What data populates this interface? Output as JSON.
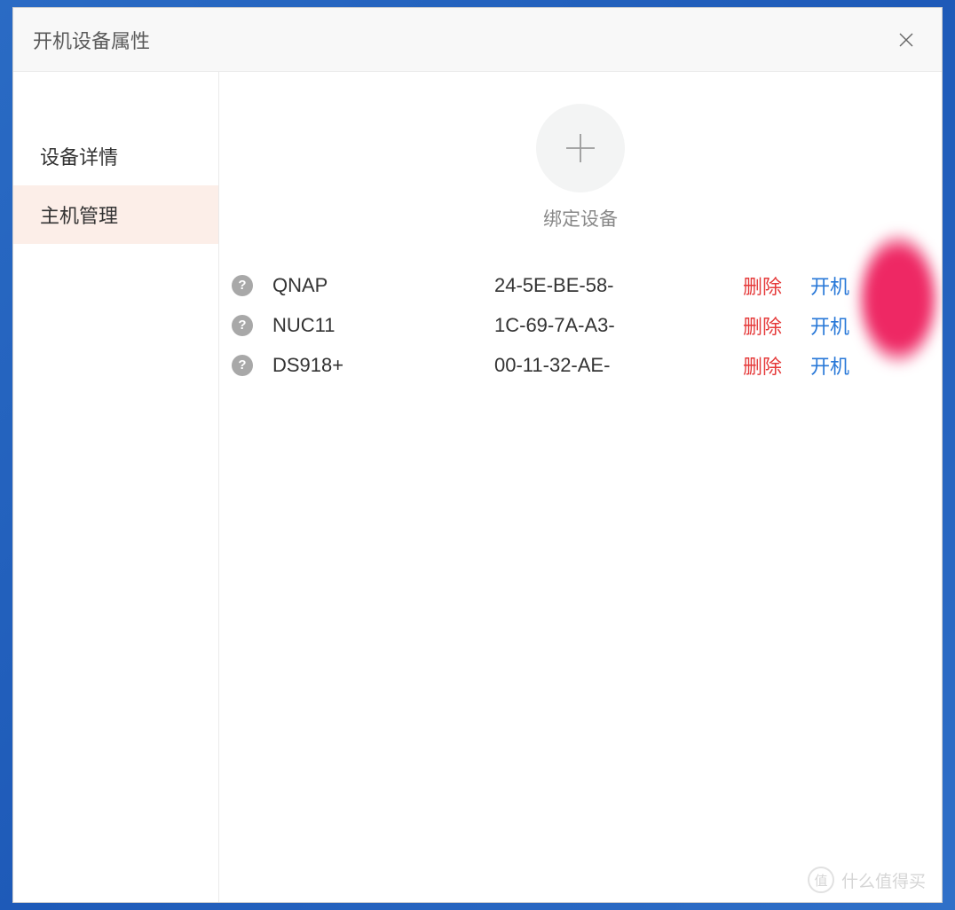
{
  "window": {
    "title": "开机设备属性"
  },
  "sidebar": {
    "items": [
      {
        "label": "设备详情",
        "active": false
      },
      {
        "label": "主机管理",
        "active": true
      }
    ]
  },
  "main": {
    "add_label": "绑定设备",
    "devices": [
      {
        "name": "QNAP",
        "mac": "24-5E-BE-58-",
        "delete_label": "删除",
        "power_label": "开机"
      },
      {
        "name": "NUC11",
        "mac": "1C-69-7A-A3-",
        "delete_label": "删除",
        "power_label": "开机"
      },
      {
        "name": "DS918+",
        "mac": "00-11-32-AE-",
        "delete_label": "删除",
        "power_label": "开机"
      }
    ]
  },
  "watermark": {
    "badge": "值",
    "text": "什么值得买"
  }
}
